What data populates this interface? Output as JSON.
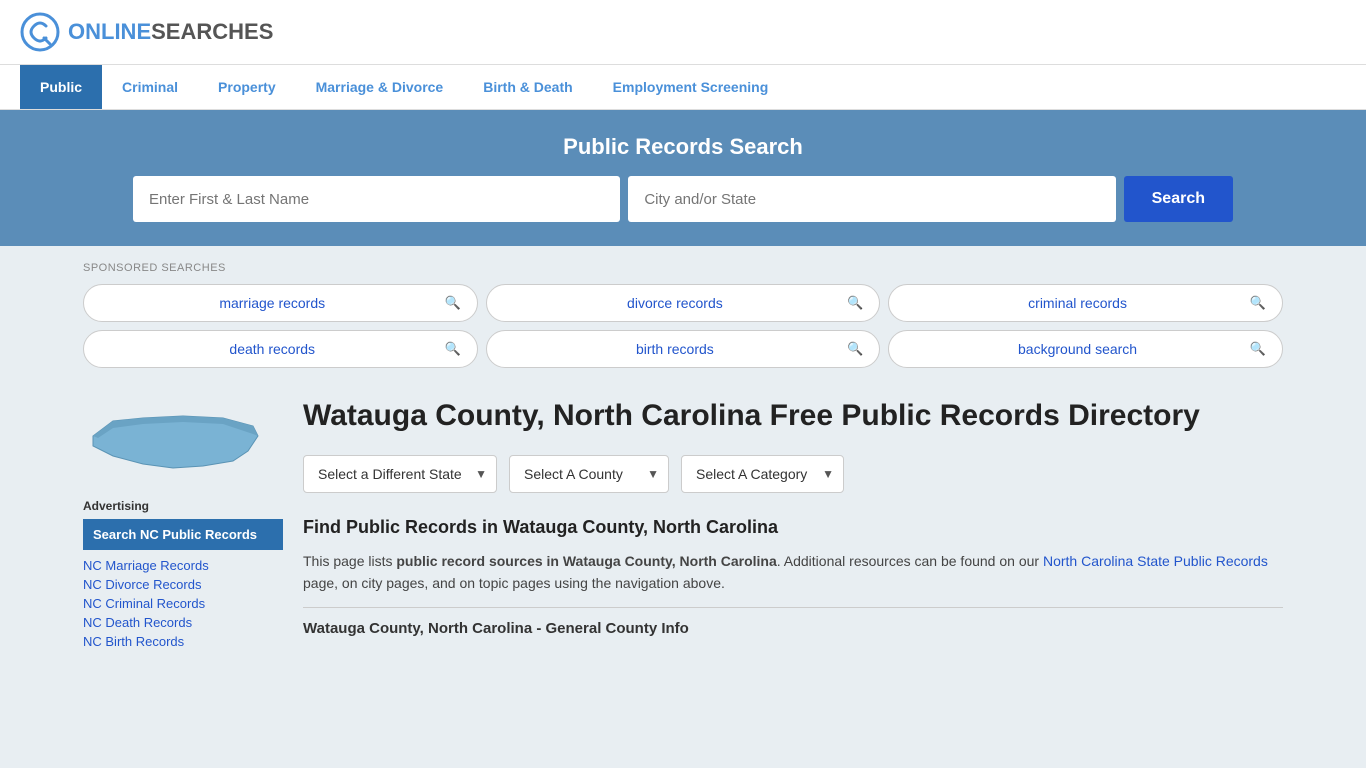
{
  "header": {
    "logo_letter": "G",
    "logo_online": "ONLINE",
    "logo_searches": "SEARCHES"
  },
  "nav": {
    "items": [
      {
        "label": "Public",
        "active": true
      },
      {
        "label": "Criminal",
        "active": false
      },
      {
        "label": "Property",
        "active": false
      },
      {
        "label": "Marriage & Divorce",
        "active": false
      },
      {
        "label": "Birth & Death",
        "active": false
      },
      {
        "label": "Employment Screening",
        "active": false
      }
    ]
  },
  "search_banner": {
    "title": "Public Records Search",
    "name_placeholder": "Enter First & Last Name",
    "city_placeholder": "City and/or State",
    "button_label": "Search"
  },
  "sponsored": {
    "label": "SPONSORED SEARCHES",
    "items": [
      {
        "label": "marriage records"
      },
      {
        "label": "divorce records"
      },
      {
        "label": "criminal records"
      },
      {
        "label": "death records"
      },
      {
        "label": "birth records"
      },
      {
        "label": "background search"
      }
    ]
  },
  "sidebar": {
    "advertising_label": "Advertising",
    "ad_box_text": "Search NC Public Records",
    "links": [
      "NC Marriage Records",
      "NC Divorce Records",
      "NC Criminal Records",
      "NC Death Records",
      "NC Birth Records"
    ]
  },
  "content": {
    "page_title": "Watauga County, North Carolina Free Public Records Directory",
    "dropdowns": {
      "state": "Select a Different State",
      "county": "Select A County",
      "category": "Select A Category"
    },
    "find_title": "Find Public Records in Watauga County, North Carolina",
    "description_plain": "This page lists ",
    "description_bold": "public record sources in Watauga County, North Carolina",
    "description_rest": ". Additional resources can be found on our ",
    "description_link": "North Carolina State Public Records",
    "description_end": " page, on city pages, and on topic pages using the navigation above.",
    "general_info_title": "Watauga County, North Carolina - General County Info"
  }
}
